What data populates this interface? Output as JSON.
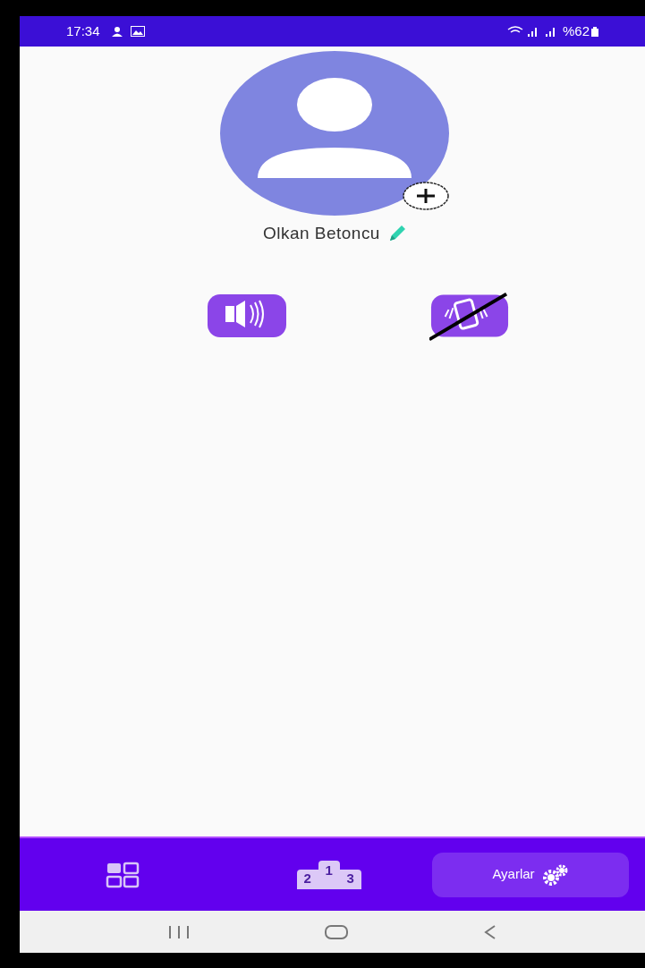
{
  "status_bar": {
    "time": "17:34",
    "battery": "%62"
  },
  "profile": {
    "name": "Olkan Betoncu"
  },
  "toggles": [
    {
      "kind": "sound",
      "on": true
    },
    {
      "kind": "vibration",
      "on": false
    }
  ],
  "tabs": [
    {
      "kind": "grid",
      "selected": false
    },
    {
      "kind": "podium",
      "digits": [
        "2",
        "1",
        "3"
      ],
      "selected": false
    },
    {
      "kind": "settings",
      "label": "Ayarlar",
      "selected": true
    }
  ]
}
